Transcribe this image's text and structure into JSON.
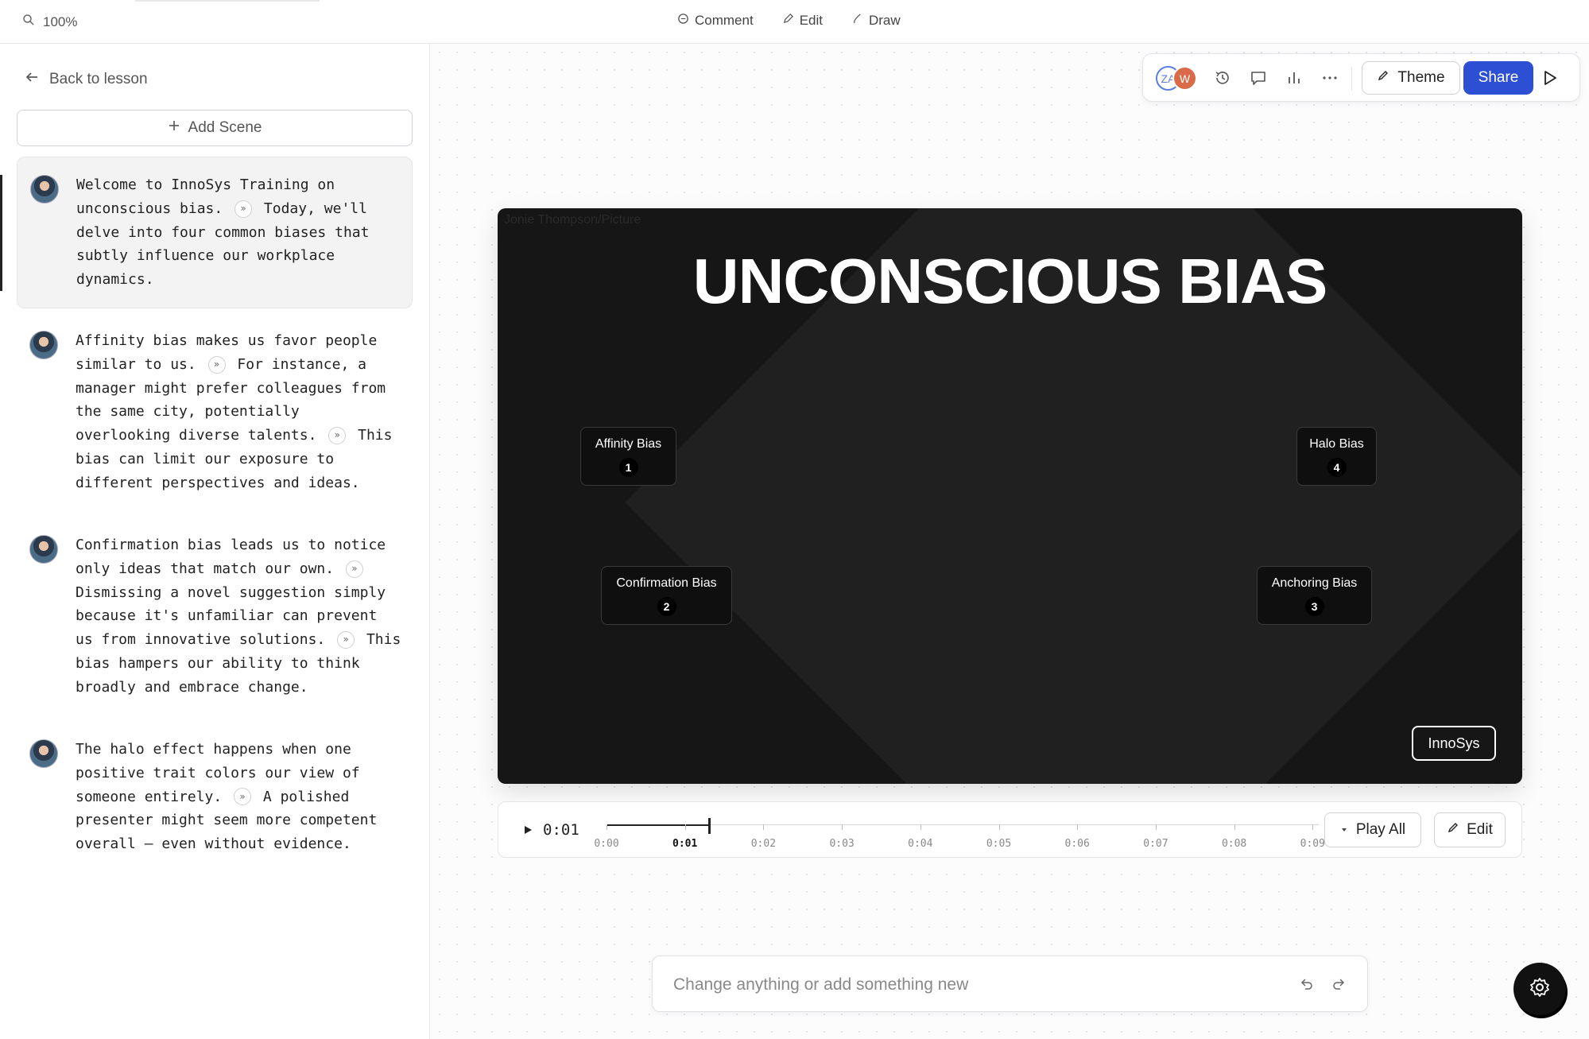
{
  "topbar": {
    "zoom": "100%",
    "modes": [
      {
        "label": "Comment",
        "icon": "comment-icon"
      },
      {
        "label": "Edit",
        "icon": "pencil-icon"
      },
      {
        "label": "Draw",
        "icon": "brush-icon"
      }
    ]
  },
  "sidebar": {
    "back_label": "Back to lesson",
    "add_scene_label": "Add Scene",
    "scenes": [
      {
        "segments": [
          "Welcome to InnoSys Training on unconscious bias.",
          "Today, we'll delve into four common biases that subtly influence our workplace dynamics."
        ]
      },
      {
        "segments": [
          "Affinity bias makes us favor people similar to us.",
          "For instance, a manager might prefer colleagues from the same city, potentially overlooking diverse talents.",
          "This bias can limit our exposure to different perspectives and ideas."
        ]
      },
      {
        "segments": [
          "Confirmation bias leads us to notice only ideas that match our own.",
          "Dismissing a novel suggestion simply because it's unfamiliar can prevent us from innovative solutions.",
          "This bias hampers our ability to think broadly and embrace change."
        ]
      },
      {
        "segments": [
          "The halo effect happens when one positive trait colors our view of someone entirely.",
          "A polished presenter might seem more competent overall — even without evidence."
        ]
      }
    ]
  },
  "toolbar": {
    "avatars": [
      "ZA",
      "W"
    ],
    "theme_label": "Theme",
    "share_label": "Share"
  },
  "slide": {
    "credit": "Jonie Thompson/Picture",
    "title": "UNCONSCIOUS BIAS",
    "cards": [
      {
        "label": "Affinity Bias",
        "num": "1"
      },
      {
        "label": "Confirmation Bias",
        "num": "2"
      },
      {
        "label": "Anchoring Bias",
        "num": "3"
      },
      {
        "label": "Halo Bias",
        "num": "4"
      }
    ],
    "brand": "InnoSys"
  },
  "timeline": {
    "current_time": "0:01",
    "ticks": [
      "0:00",
      "0:01",
      "0:02",
      "0:03",
      "0:04",
      "0:05",
      "0:06",
      "0:07",
      "0:08",
      "0:09"
    ],
    "current_index": 1,
    "play_all_label": "Play All",
    "edit_label": "Edit"
  },
  "prompt": {
    "placeholder": "Change anything or add something new"
  },
  "colors": {
    "accent": "#2d4fd4",
    "slide_bg": "#161616",
    "avatar_w": "#d96a4a"
  }
}
